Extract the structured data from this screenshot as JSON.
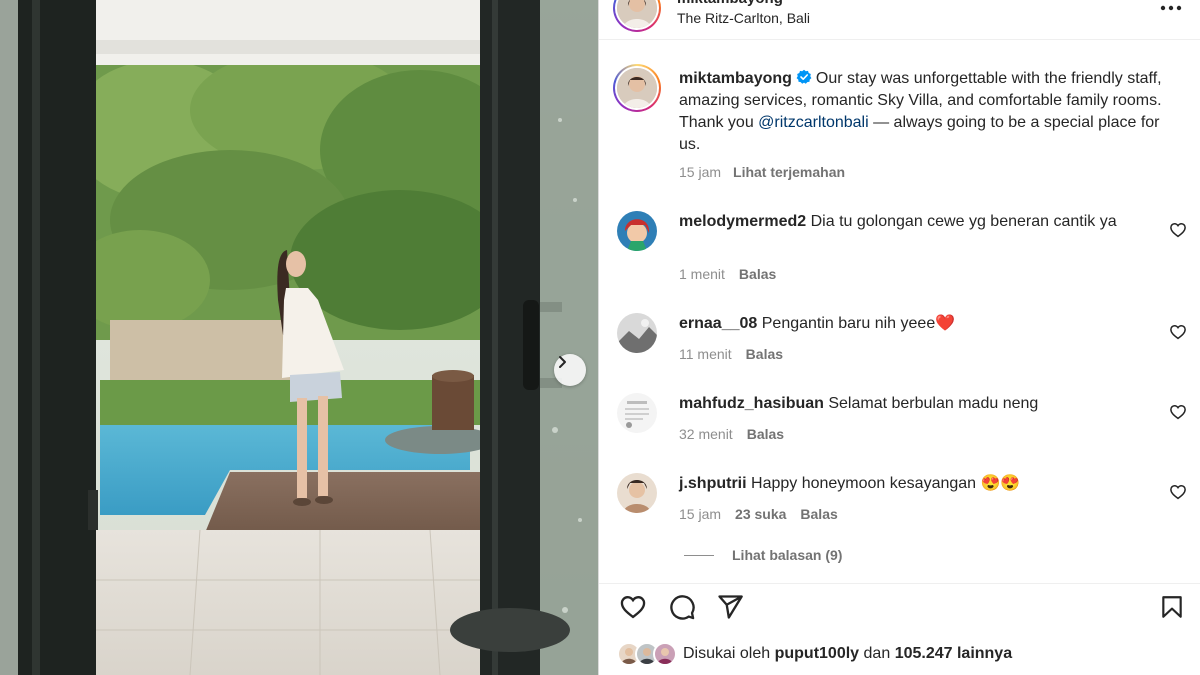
{
  "post": {
    "header": {
      "username": "miktambayong",
      "location": "The Ritz-Carlton, Bali",
      "more_icon": "more-horizontal-icon"
    },
    "caption": {
      "username": "miktambayong",
      "text_before": "Our stay was unforgettable with the friendly staff, amazing services, romantic Sky Villa, and comfortable family rooms. Thank you ",
      "mention": "@ritzcarltonbali",
      "text_after": " — always going to be a special place for us.",
      "time": "15 jam",
      "translate_label": "Lihat terjemahan"
    },
    "comments": [
      {
        "username": "melodymermed2",
        "text": "Dia tu golongan cewe yg beneran cantik ya",
        "time": "1 menit",
        "likes": "",
        "reply_label": "Balas"
      },
      {
        "username": "ernaa__08",
        "text": "Pengantin baru nih yeee❤️",
        "time": "11 menit",
        "likes": "",
        "reply_label": "Balas"
      },
      {
        "username": "mahfudz_hasibuan",
        "text": "Selamat berbulan madu neng",
        "time": "32 menit",
        "likes": "",
        "reply_label": "Balas"
      },
      {
        "username": "j.shputrii",
        "text": "Happy honeymoon kesayangan 😍😍",
        "time": "15 jam",
        "likes": "23 suka",
        "reply_label": "Balas"
      }
    ],
    "view_replies_label": "Lihat balasan (9)",
    "likes_summary": {
      "prefix": "Disukai oleh",
      "liker": "puput100ly",
      "connector": "dan",
      "count": "105.247 lainnya"
    },
    "icons": {
      "like": "heart-icon",
      "comment": "comment-icon",
      "share": "send-icon",
      "save": "bookmark-icon",
      "next": "chevron-right-icon",
      "verified": "verified-badge-icon"
    },
    "colors": {
      "link": "#00376b",
      "secondary_text": "#8e8e8e",
      "verified": "#0095f6"
    }
  }
}
